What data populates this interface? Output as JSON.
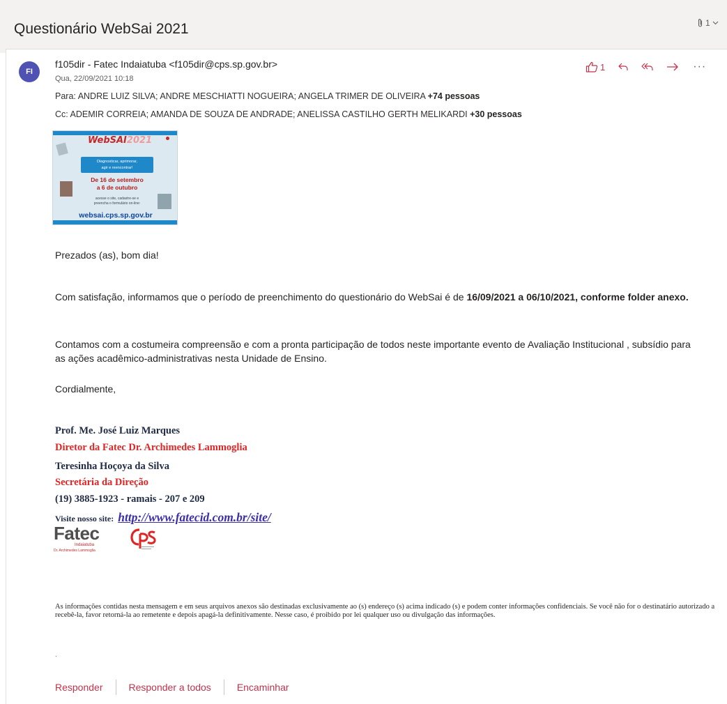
{
  "header": {
    "subject": "Questionário WebSai 2021",
    "attachment_count": "1"
  },
  "message": {
    "avatar_initials": "FI",
    "sender": "f105dir - Fatec Indaiatuba <f105dir@cps.sp.gov.br>",
    "date": "Qua, 22/09/2021 10:18",
    "to_label": "Para:",
    "to_list": "ANDRE LUIZ SILVA; ANDRE MESCHIATTI NOGUEIRA; ANGELA TRIMER DE OLIVEIRA",
    "to_more": "+74 pessoas",
    "cc_label": "Cc:",
    "cc_list": "ADEMIR CORREIA; AMANDA DE SOUZA DE ANDRADE; ANELISSA CASTILHO GERTH MELIKARDI",
    "cc_more": "+30 pessoas",
    "like_count": "1",
    "more_label": "···"
  },
  "flyer": {
    "title_main": "WebSAI",
    "title_year": "2021",
    "box_line1": "Diagnosticar, aprimorar,",
    "box_line2": "agir e reencontrar!",
    "dates_line1": "De 16 de setembro",
    "dates_line2": "a 6 de outubro",
    "small_line1": "acesse o site, cadastre-se e",
    "small_line2": "preencha o formulário on-line:",
    "url": "websai.cps.sp.gov.br"
  },
  "body": {
    "greeting": "Prezados (as), bom dia!",
    "p2_text": "Com satisfação, informamos que o período de preenchimento do questionário do WebSai é de ",
    "p2_bold": "16/09/2021 a 06/10/2021, conforme folder anexo.",
    "p3": "Contamos com a costumeira compreensão e com a  pronta participação de todos neste importante evento de Avaliação Institucional , subsídio para as ações acadêmico-administrativas nesta Unidade de Ensino.",
    "closing": "Cordialmente,"
  },
  "signature": {
    "name1": "Prof. Me. José Luiz Marques",
    "role1": "Diretor da Fatec  Dr. Archimedes Lammoglia",
    "name2": "Teresinha Hoçoya da Silva",
    "role2": "Secretária da Direção",
    "phone": "(19) 3885-1923 - ramais - 207 e 209",
    "site_label": "Visite nosso site:",
    "site_url": "http://www.fatecid.com.br/site/",
    "logo_fatec": "Fatec",
    "logo_fatec_sub": "Indaiatuba",
    "logo_fatec_sub2": "Dr. Archimedes Lammoglia"
  },
  "disclaimer": "As informações contidas nesta mensagem e em seus arquivos anexos são destinadas exclusivamente ao (s) endereço (s) acima indicado (s) e podem conter informações confidenciais. Se você não for o destinatário autorizado a recebê-la, favor retorná-la ao remetente e depois apagá-la definitivamente. Nesse caso, é proibido por lei qualquer uso ou divulgação das informações.",
  "stray_dot": ".",
  "reply_bar": {
    "reply": "Responder",
    "reply_all": "Responder a todos",
    "forward": "Encaminhar"
  },
  "colors": {
    "accent": "#c4314b",
    "avatar": "#4f52b2",
    "signature_red": "#e02424",
    "signature_dark": "#1f2a44",
    "link": "#3b2fa8"
  }
}
